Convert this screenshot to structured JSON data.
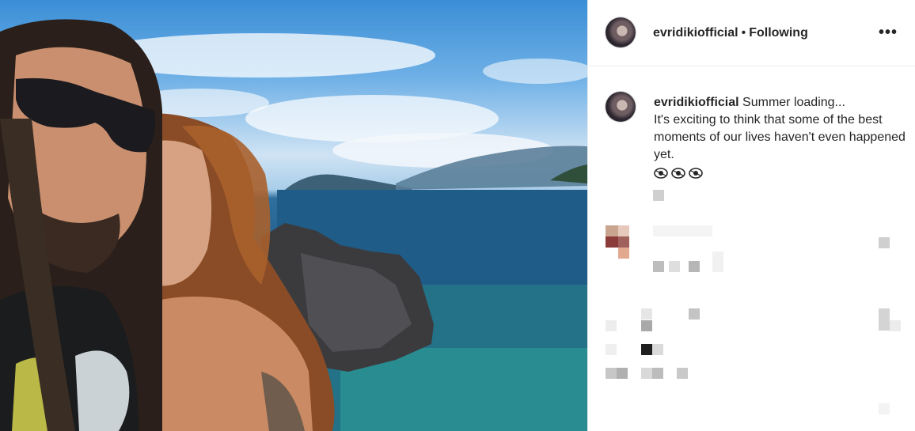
{
  "post": {
    "username": "evridikiofficial",
    "separator": "•",
    "follow_status": "Following",
    "more_label": "•••"
  },
  "caption": {
    "username": "evridikiofficial",
    "text": "Summer loading...",
    "line2": "It's exciting to think that some of the best moments of our lives haven't even happened yet."
  },
  "icons": {
    "more": "more-options-icon",
    "emoji": "eye-emoji-icon"
  }
}
